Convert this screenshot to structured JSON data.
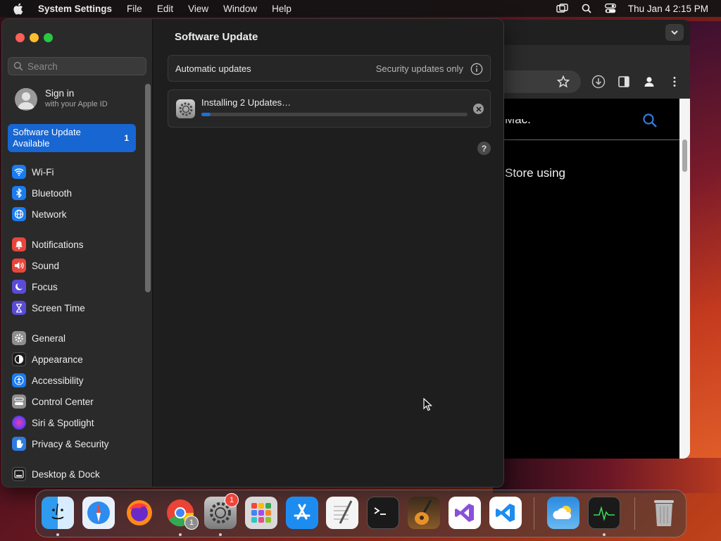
{
  "menubar": {
    "app_name": "System Settings",
    "items": [
      "File",
      "Edit",
      "View",
      "Window",
      "Help"
    ],
    "clock": "Thu Jan 4  2:15 PM"
  },
  "browser": {
    "fragment_1": "Mac.",
    "fragment_2": "Store using"
  },
  "sidebar": {
    "search_placeholder": "Search",
    "signin_title": "Sign in",
    "signin_subtitle": "with your Apple ID",
    "update_label_line1": "Software Update",
    "update_label_line2": "Available",
    "update_badge": "1",
    "items": [
      {
        "label": "Wi-Fi",
        "color": "#1a7cf0"
      },
      {
        "label": "Bluetooth",
        "color": "#1a7cf0"
      },
      {
        "label": "Network",
        "color": "#1a7cf0"
      },
      {
        "label": "Notifications",
        "color": "#e8463d"
      },
      {
        "label": "Sound",
        "color": "#e8463d"
      },
      {
        "label": "Focus",
        "color": "#5a4bd8"
      },
      {
        "label": "Screen Time",
        "color": "#5a4bd8"
      },
      {
        "label": "General",
        "color": "#8e8e8e"
      },
      {
        "label": "Appearance",
        "color": "#1c1c1c"
      },
      {
        "label": "Accessibility",
        "color": "#1a7cf0"
      },
      {
        "label": "Control Center",
        "color": "#8e8e8e"
      },
      {
        "label": "Siri & Spotlight",
        "color": "#c04bd8"
      },
      {
        "label": "Privacy & Security",
        "color": "#2f7be0"
      },
      {
        "label": "Desktop & Dock",
        "color": "#1c1c1c"
      }
    ]
  },
  "main": {
    "title": "Software Update",
    "auto_updates_label": "Automatic updates",
    "auto_updates_value": "Security updates only",
    "installing_label": "Installing 2 Updates…",
    "progress_fraction": 0.035,
    "help_label": "?"
  },
  "dock": {
    "apps": [
      "Finder",
      "Safari",
      "Firefox",
      "Google Chrome",
      "System Settings",
      "Launchpad",
      "App Store",
      "TextEdit",
      "Terminal",
      "GarageBand",
      "Visual Studio",
      "Visual Studio Code",
      "Weather",
      "Activity Monitor",
      "Trash"
    ],
    "settings_badge": "1",
    "chrome_badge": "1"
  }
}
